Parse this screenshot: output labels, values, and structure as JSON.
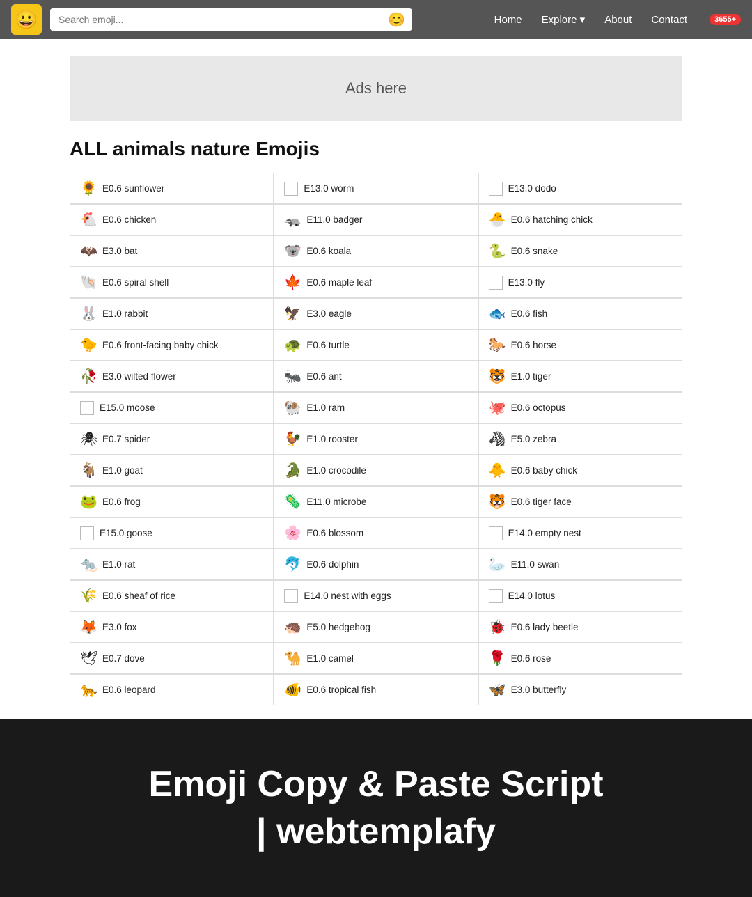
{
  "navbar": {
    "logo_emoji": "😀",
    "search_placeholder": "Search emoji...",
    "search_btn_emoji": "😊",
    "links": [
      {
        "label": "Home",
        "name": "home-link"
      },
      {
        "label": "Explore ▾",
        "name": "explore-link"
      },
      {
        "label": "About",
        "name": "about-link"
      },
      {
        "label": "Contact",
        "name": "contact-link"
      }
    ],
    "badge": "3655+"
  },
  "ads": {
    "text": "Ads here"
  },
  "page_title": "ALL animals nature Emojis",
  "emojis": {
    "col1": [
      {
        "icon": "🌻",
        "label": "E0.6 sunflower"
      },
      {
        "icon": "🐔",
        "label": "E0.6 chicken"
      },
      {
        "icon": "🦇",
        "label": "E3.0 bat"
      },
      {
        "icon": "🐚",
        "label": "E0.6 spiral shell"
      },
      {
        "icon": "🐰",
        "label": "E1.0 rabbit"
      },
      {
        "icon": "🐤",
        "label": "E0.6 front-facing baby chick"
      },
      {
        "icon": "🥀",
        "label": "E3.0 wilted flower"
      },
      {
        "icon": "",
        "label": "E15.0 moose",
        "placeholder": true
      },
      {
        "icon": "🕷",
        "label": "E0.7 spider"
      },
      {
        "icon": "🐐",
        "label": "E1.0 goat"
      },
      {
        "icon": "🐸",
        "label": "E0.6 frog"
      },
      {
        "icon": "",
        "label": "E15.0 goose",
        "placeholder": true
      },
      {
        "icon": "🐀",
        "label": "E1.0 rat"
      },
      {
        "icon": "🌾",
        "label": "E0.6 sheaf of rice"
      },
      {
        "icon": "🦊",
        "label": "E3.0 fox"
      },
      {
        "icon": "🕊",
        "label": "E0.7 dove"
      },
      {
        "icon": "🐆",
        "label": "E0.6 leopard"
      }
    ],
    "col2": [
      {
        "icon": "",
        "label": "E13.0 worm",
        "placeholder": true
      },
      {
        "icon": "🦡",
        "label": "E11.0 badger"
      },
      {
        "icon": "🐨",
        "label": "E0.6 koala"
      },
      {
        "icon": "🍁",
        "label": "E0.6 maple leaf"
      },
      {
        "icon": "🦅",
        "label": "E3.0 eagle"
      },
      {
        "icon": "🐢",
        "label": "E0.6 turtle"
      },
      {
        "icon": "🐜",
        "label": "E0.6 ant"
      },
      {
        "icon": "🐏",
        "label": "E1.0 ram"
      },
      {
        "icon": "🐓",
        "label": "E1.0 rooster"
      },
      {
        "icon": "🐊",
        "label": "E1.0 crocodile"
      },
      {
        "icon": "🦠",
        "label": "E11.0 microbe"
      },
      {
        "icon": "🌸",
        "label": "E0.6 blossom"
      },
      {
        "icon": "🐬",
        "label": "E0.6 dolphin"
      },
      {
        "icon": "",
        "label": "E14.0 nest with eggs",
        "placeholder": true
      },
      {
        "icon": "🦔",
        "label": "E5.0 hedgehog"
      },
      {
        "icon": "🐪",
        "label": "E1.0 camel"
      },
      {
        "icon": "🐠",
        "label": "E0.6 tropical fish"
      }
    ],
    "col3": [
      {
        "icon": "",
        "label": "E13.0 dodo",
        "placeholder": true
      },
      {
        "icon": "🐣",
        "label": "E0.6 hatching chick"
      },
      {
        "icon": "🐍",
        "label": "E0.6 snake"
      },
      {
        "icon": "",
        "label": "E13.0 fly",
        "placeholder": true
      },
      {
        "icon": "🐟",
        "label": "E0.6 fish"
      },
      {
        "icon": "🐎",
        "label": "E0.6 horse"
      },
      {
        "icon": "🐯",
        "label": "E1.0 tiger"
      },
      {
        "icon": "🐙",
        "label": "E0.6 octopus"
      },
      {
        "icon": "🦓",
        "label": "E5.0 zebra"
      },
      {
        "icon": "🐥",
        "label": "E0.6 baby chick"
      },
      {
        "icon": "🐯",
        "label": "E0.6 tiger face"
      },
      {
        "icon": "",
        "label": "E14.0 empty nest",
        "placeholder": true
      },
      {
        "icon": "🦢",
        "label": "E11.0 swan"
      },
      {
        "icon": "",
        "label": "E14.0 lotus",
        "placeholder": true
      },
      {
        "icon": "🐞",
        "label": "E0.6 lady beetle"
      },
      {
        "icon": "🌹",
        "label": "E0.6 rose"
      },
      {
        "icon": "🦋",
        "label": "E3.0 butterfly"
      }
    ]
  },
  "bottom_banner": {
    "line1": "Emoji Copy & Paste Script",
    "line2": "| webtemplafy"
  }
}
